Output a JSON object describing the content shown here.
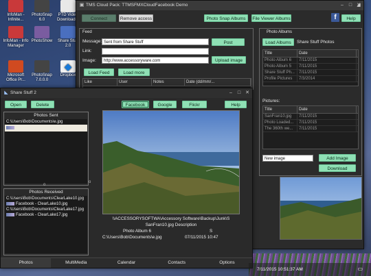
{
  "desktop": {
    "icons": [
      {
        "label": "InfoMan - Infinite..."
      },
      {
        "label": "PhotoSnap 6.0"
      },
      {
        "label": "PTD Video Downloader"
      },
      {
        "label": "InfoMan - Info Manager"
      },
      {
        "label": "PhotoShow"
      },
      {
        "label": "Share Stuff 2.0"
      },
      {
        "label": "Microsoft Office Pr..."
      },
      {
        "label": "PhotoSnap 7.0.0.0"
      },
      {
        "label": "Dropbox"
      }
    ]
  },
  "main_window": {
    "title": "TMS Cloud Pack: TTMSFMXCloudFacebook Demo",
    "connect_label": "Connect",
    "remove_access_label": "Remove access",
    "photo_snap_albums_label": "Photo Snap Albums",
    "file_viewer_albums_label": "File Viewer Albums",
    "help_label": "Help",
    "feed": {
      "group_label": "Feed",
      "message_label": "Message:",
      "message_value": "Sent from Share Stuff",
      "link_label": "Link:",
      "link_value": "",
      "image_label": "Image:",
      "image_value": "http://www.accessoryware.com",
      "post_label": "Post",
      "upload_image_label": "Upload image",
      "load_feed_label": "Load Feed",
      "load_more_label": "Load more",
      "columns": [
        "Like",
        "User",
        "Notes",
        "Date (dd/mm/..."
      ]
    },
    "albums": {
      "group_label": "Photo Albums",
      "load_albums_label": "Load Albums",
      "share_stuff_photos_label": "Share Stuff Photos",
      "columns": [
        "Title",
        "Date"
      ],
      "rows": [
        [
          "Photo Album 6",
          "7/11/2015"
        ],
        [
          "Photo Album 5",
          "7/11/2015"
        ],
        [
          "Share Stuff Ph...",
          "7/11/2015"
        ],
        [
          "Profile Pictures",
          "7/3/2014"
        ]
      ],
      "pictures_label": "Pictures:",
      "pictures_columns": [
        "Title",
        "Date"
      ],
      "pictures_rows": [
        [
          "SanFran10.jpg",
          "7/11/2015"
        ],
        [
          "Photo Loaded...",
          "7/11/2015"
        ],
        [
          "The 360th we...",
          "7/11/2015"
        ]
      ],
      "new_image_value": "New image",
      "add_image_label": "Add Image",
      "download_label": "Download"
    }
  },
  "share_window": {
    "title": "Share Stuff 2",
    "open_label": "Open",
    "delete_label": "Delete",
    "facebook_label": "Facebook",
    "google_label": "Google",
    "flickr_label": "Flickr",
    "help_label": "Help",
    "photos_sent_label": "Photos Sent",
    "photos_sent_items": [
      "C:\\Users\\Bob\\Documents\\e.jpg"
    ],
    "photos_received_label": "Photos Received",
    "photos_received_items": [
      "C:\\Users\\Bob\\Documents\\ClearLake10.jpg",
      "Facebook - ClearLake10.jpg",
      "C:\\Users\\Bob\\Documents\\ClearLake17.jpg",
      "Facebook - ClearLake17.jpg"
    ],
    "info_path": "\\\\ACCESSORYSOFTWA\\Accessory Software\\Backup\\Junk\\S",
    "info_description": "SanFran10.jpg Description",
    "info_album": "Photo Album 6",
    "info_s": "S",
    "info_file": "C:\\Users\\Bob\\Documents\\e.jpg",
    "info_datetime": "07/11/2015 10:47",
    "tabs": [
      "Photos",
      "MultiMedia",
      "Calendar",
      "Contacts",
      "Options"
    ]
  },
  "taskbar": {
    "clock": "7/11/2015 10:51:37 AM"
  },
  "colors": {
    "accent_green": "#8fe0b5",
    "window_dark": "#2b2b2b",
    "facebook_blue": "#3b5998"
  }
}
